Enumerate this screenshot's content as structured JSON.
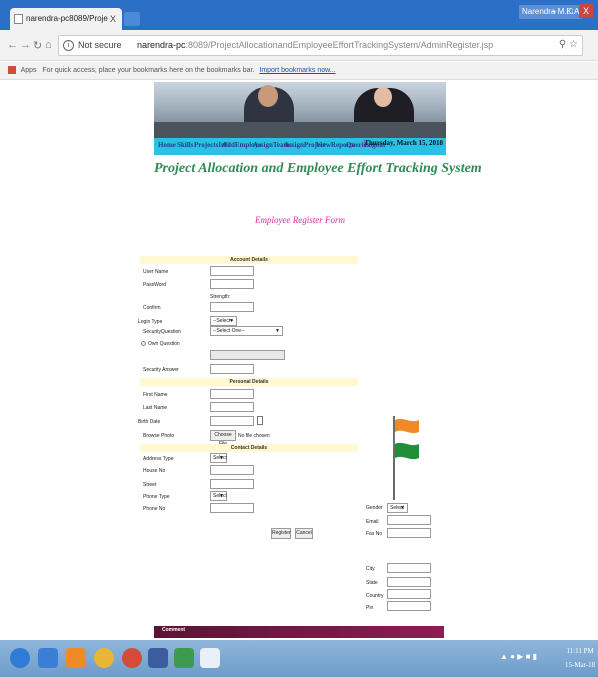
{
  "browser": {
    "tab_title": "narendra-pc8089/Proje",
    "tab_close": "X",
    "window_user": "Narendra M.K.A",
    "window_min": "–",
    "window_max": "□",
    "window_close": "X",
    "security_label": "Not secure",
    "url_host": "narendra-pc",
    "url_rest": ":8089/ProjectAllocationandEmployeeEffortTrackingSystem/AdminRegister.jsp",
    "bookmarks_apps": "Apps",
    "bookmarks_hint": "For quick access, place your bookmarks here on the bookmarks bar.",
    "bookmarks_import": "Import bookmarks now..."
  },
  "nav": {
    "links": [
      "Home",
      "Skills",
      "ProjectsInfo",
      "AddEmploye",
      "AssignTeams",
      "AssignProject",
      "ViewReports",
      "Queries",
      "Logout"
    ],
    "date": "Thursday, March 15, 2018"
  },
  "page_title": "Project Allocation and Employee Effort Tracking System",
  "form_title": "Employee Register Form",
  "account": {
    "heading": "Account Details",
    "user_name_label": "User Name",
    "password_label": "PassWord",
    "strength_label": "Strength:",
    "confirm_label": "Confirm",
    "login_type_label": "Login Type",
    "login_type_value": "--Select--",
    "security_question_label": "SecurityQuestion",
    "security_question_value": "--Select One--",
    "own_question_label": "Own Question",
    "security_answer_label": "Security Answer"
  },
  "personal": {
    "heading": "Personal Details",
    "first_name_label": "First Name",
    "last_name_label": "Last Name",
    "birth_date_label": "Birth Date",
    "browse_photo_label": "Browse Photo",
    "choose_file_label": "Choose File",
    "no_file_label": "No file chosen"
  },
  "contact": {
    "heading": "Contact Details",
    "address_type_label": "Address Type",
    "address_type_value": "Select",
    "house_no_label": "House No",
    "street_label": "Street",
    "phone_type_label": "Phone Type",
    "phone_type_value": "Select",
    "phone_no_label": "Phone No",
    "gender_label": "Gender",
    "gender_value": "Select",
    "email_label": "Email",
    "fax_label": "Fax No",
    "city_label": "City",
    "state_label": "State",
    "country_label": "Country",
    "pin_label": "Pin"
  },
  "buttons": {
    "register": "Register",
    "cancel": "Cancel"
  },
  "footer_text": "Comment",
  "taskbar": {
    "time": "11:11 PM",
    "date": "15-Mar-18"
  }
}
